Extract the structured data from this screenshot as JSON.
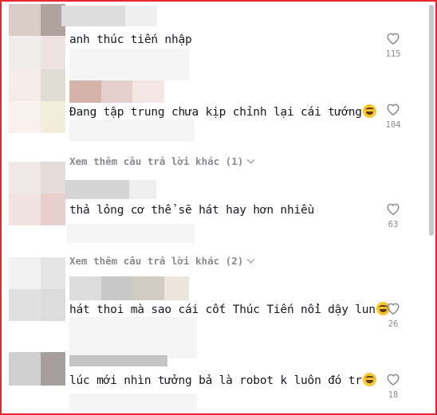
{
  "comments": [
    {
      "text": "anh thúc tiến nhập",
      "likes": "115"
    },
    {
      "text": "Đang tập trung chưa kịp chỉnh lại cái tướng",
      "likes": "104",
      "emoji": "grinning-sweat"
    },
    {
      "text": "thả lỏng cơ thể sẽ hát hay hơn nhiều",
      "likes": "63"
    },
    {
      "text": "hát thoi mà sao cái cốt Thúc Tiến nổi dậy lun",
      "likes": "26",
      "emoji": "grinning-sweat"
    },
    {
      "text": "lúc mới nhìn tưởng bả là robot k luôn đó tr",
      "likes": "18",
      "emoji": "grinning-sweat"
    }
  ],
  "replies": [
    {
      "label": "Xem thêm câu trả lời khác (1)"
    },
    {
      "label": "Xem thêm câu trả lời khác (2)"
    }
  ],
  "colors": {
    "border": "#e8262f",
    "text": "#161823",
    "muted": "#8a8b91"
  }
}
